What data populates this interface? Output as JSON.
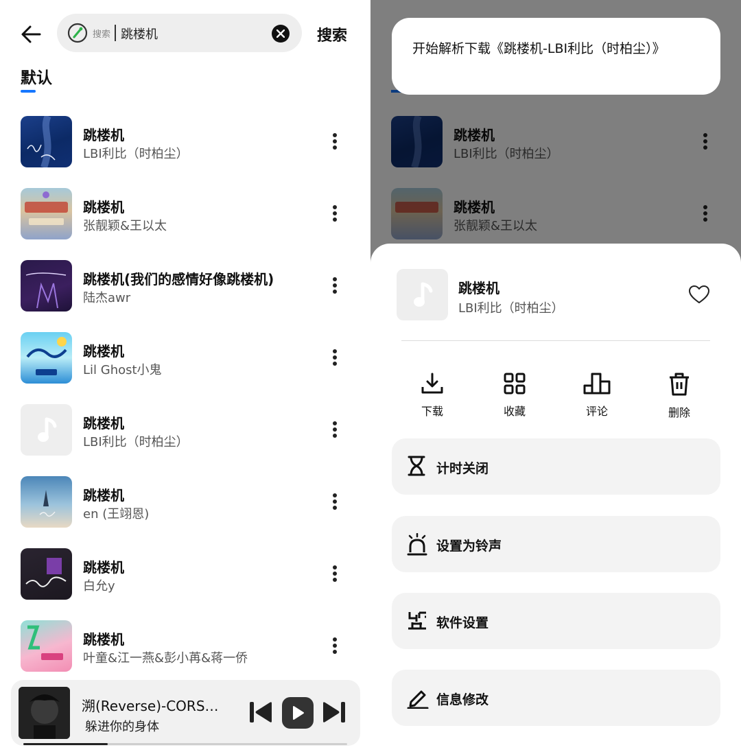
{
  "search": {
    "hint": "搜索",
    "query": "跳楼机",
    "submit_label": "搜索"
  },
  "tabs": {
    "default_label": "默认"
  },
  "results": [
    {
      "title": "跳楼机",
      "artist": "LBI利比（时柏尘）"
    },
    {
      "title": "跳楼机",
      "artist": "张靓颖&王以太"
    },
    {
      "title": "跳楼机(我们的感情好像跳楼机)",
      "artist": "陆杰awr"
    },
    {
      "title": "跳楼机",
      "artist": "Lil Ghost小鬼"
    },
    {
      "title": "跳楼机",
      "artist": "LBI利比（时柏尘）"
    },
    {
      "title": "跳楼机",
      "artist": "en (王翊恩)"
    },
    {
      "title": "跳楼机",
      "artist": "白允y"
    },
    {
      "title": "跳楼机",
      "artist": "叶童&江一燕&彭小苒&蒋一侨"
    }
  ],
  "player": {
    "title": "溯(Reverse)-CORS…",
    "subtitle": "躲进你的身体",
    "progress": 0.26
  },
  "toast": {
    "text": "开始解析下载《跳楼机-LBI利比（时柏尘）》"
  },
  "sheet": {
    "title": "跳楼机",
    "artist": "LBI利比（时柏尘）",
    "actions": {
      "download": "下载",
      "collect": "收藏",
      "comment": "评论",
      "delete": "删除"
    },
    "options": {
      "timer": "计时关闭",
      "ringtone": "设置为铃声",
      "settings": "软件设置",
      "edit_info": "信息修改"
    }
  },
  "colors": {
    "accent": "#1677ff",
    "search_logo": "#2db34a"
  }
}
